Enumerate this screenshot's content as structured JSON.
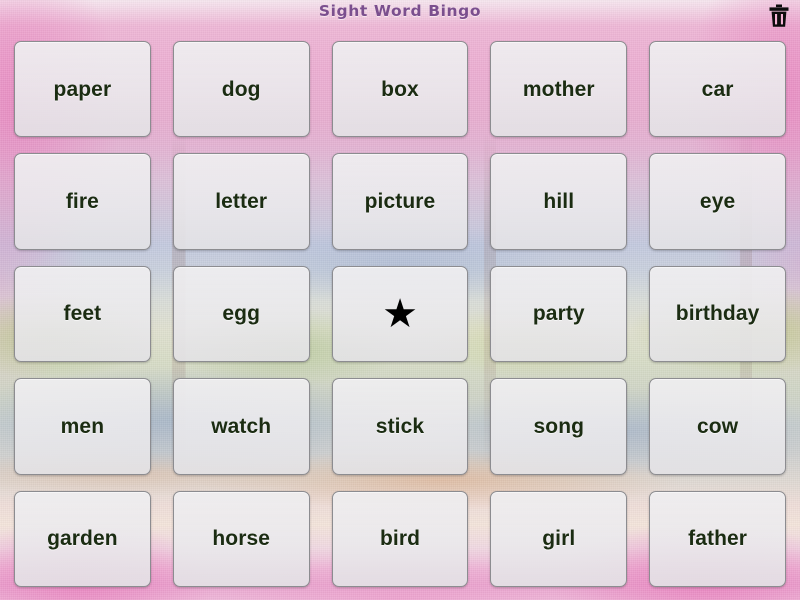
{
  "app": {
    "title": "Sight Word Bingo",
    "title_color": "#7b4f8e",
    "card_text_color": "#1b2c12",
    "card_bg_color": "#eceaed"
  },
  "header": {
    "title": "Sight Word Bingo",
    "trash_icon": "trash-icon",
    "trash_label": "Clear board"
  },
  "board": {
    "rows": 5,
    "columns": 5,
    "free_space_glyph": "★",
    "free_space_index": 12,
    "cells": [
      {
        "label": "paper",
        "type": "word"
      },
      {
        "label": "dog",
        "type": "word"
      },
      {
        "label": "box",
        "type": "word"
      },
      {
        "label": "mother",
        "type": "word"
      },
      {
        "label": "car",
        "type": "word"
      },
      {
        "label": "fire",
        "type": "word"
      },
      {
        "label": "letter",
        "type": "word"
      },
      {
        "label": "picture",
        "type": "word"
      },
      {
        "label": "hill",
        "type": "word"
      },
      {
        "label": "eye",
        "type": "word"
      },
      {
        "label": "feet",
        "type": "word"
      },
      {
        "label": "egg",
        "type": "word"
      },
      {
        "label": "★",
        "type": "free"
      },
      {
        "label": "party",
        "type": "word"
      },
      {
        "label": "birthday",
        "type": "word"
      },
      {
        "label": "men",
        "type": "word"
      },
      {
        "label": "watch",
        "type": "word"
      },
      {
        "label": "stick",
        "type": "word"
      },
      {
        "label": "song",
        "type": "word"
      },
      {
        "label": "cow",
        "type": "word"
      },
      {
        "label": "garden",
        "type": "word"
      },
      {
        "label": "horse",
        "type": "word"
      },
      {
        "label": "bird",
        "type": "word"
      },
      {
        "label": "girl",
        "type": "word"
      },
      {
        "label": "father",
        "type": "word"
      }
    ]
  }
}
